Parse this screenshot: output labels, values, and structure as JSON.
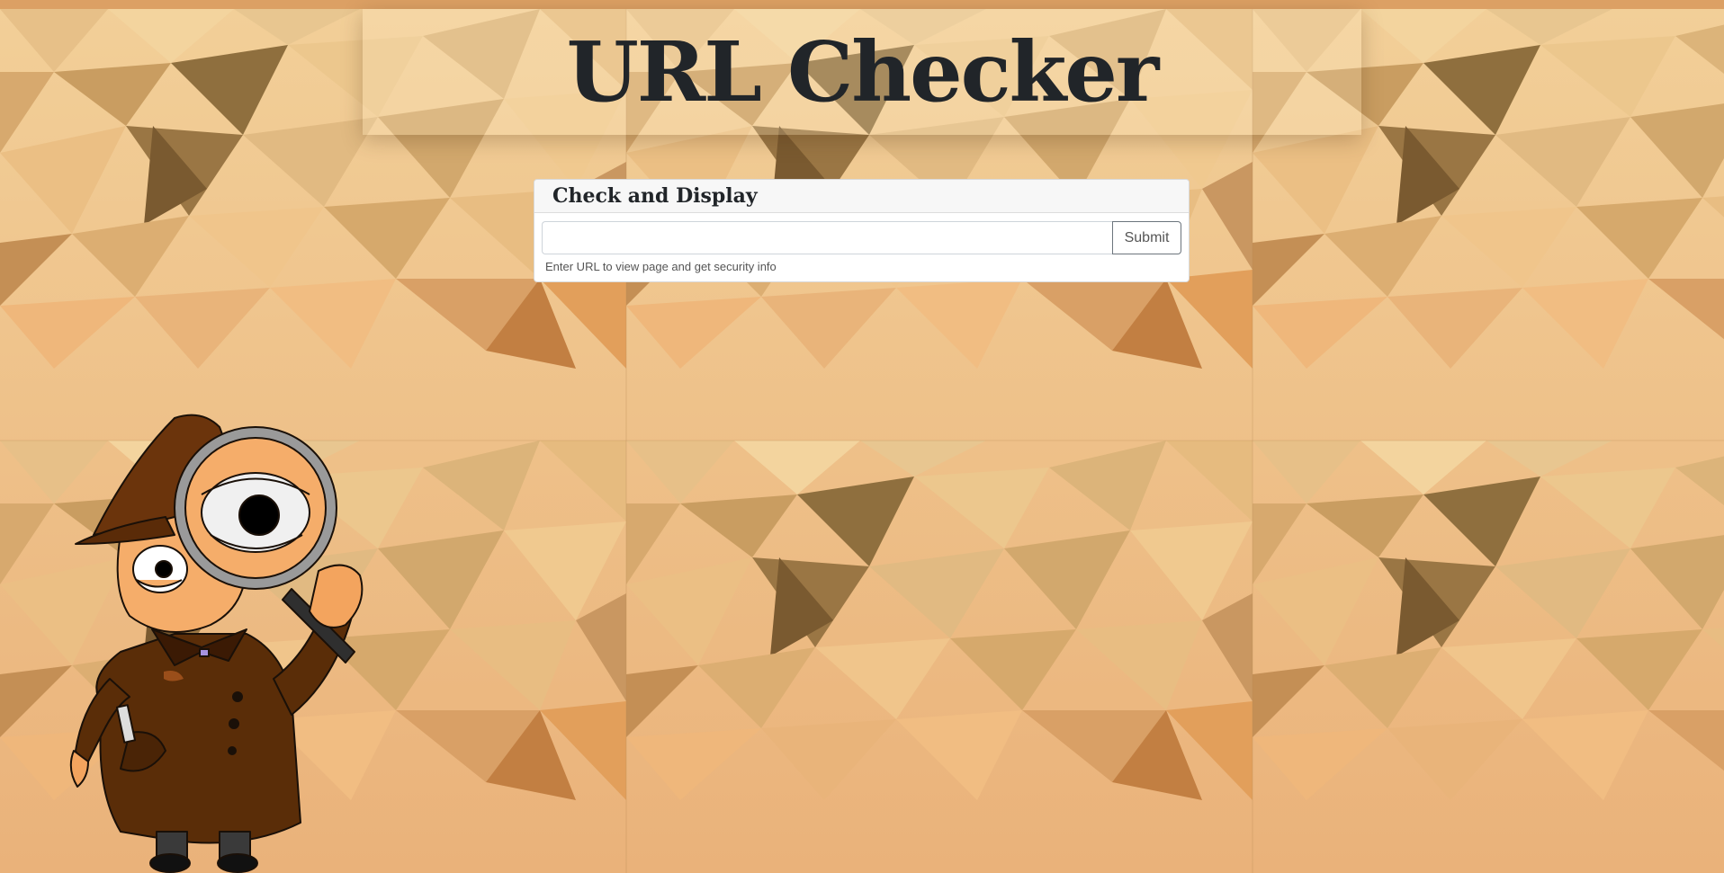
{
  "page": {
    "title": "URL Checker"
  },
  "checker": {
    "header": "Check and Display",
    "url_value": "",
    "url_placeholder": "",
    "submit_label": "Submit",
    "help_text": "Enter URL to view page and get security info"
  },
  "illustration": {
    "icon": "detective-with-magnifying-glass-icon"
  },
  "colors": {
    "background": "#e9b877",
    "title_text": "#212529",
    "card_bg": "#ffffff",
    "card_header_bg": "#f7f7f7",
    "button_border": "#6c757d"
  }
}
